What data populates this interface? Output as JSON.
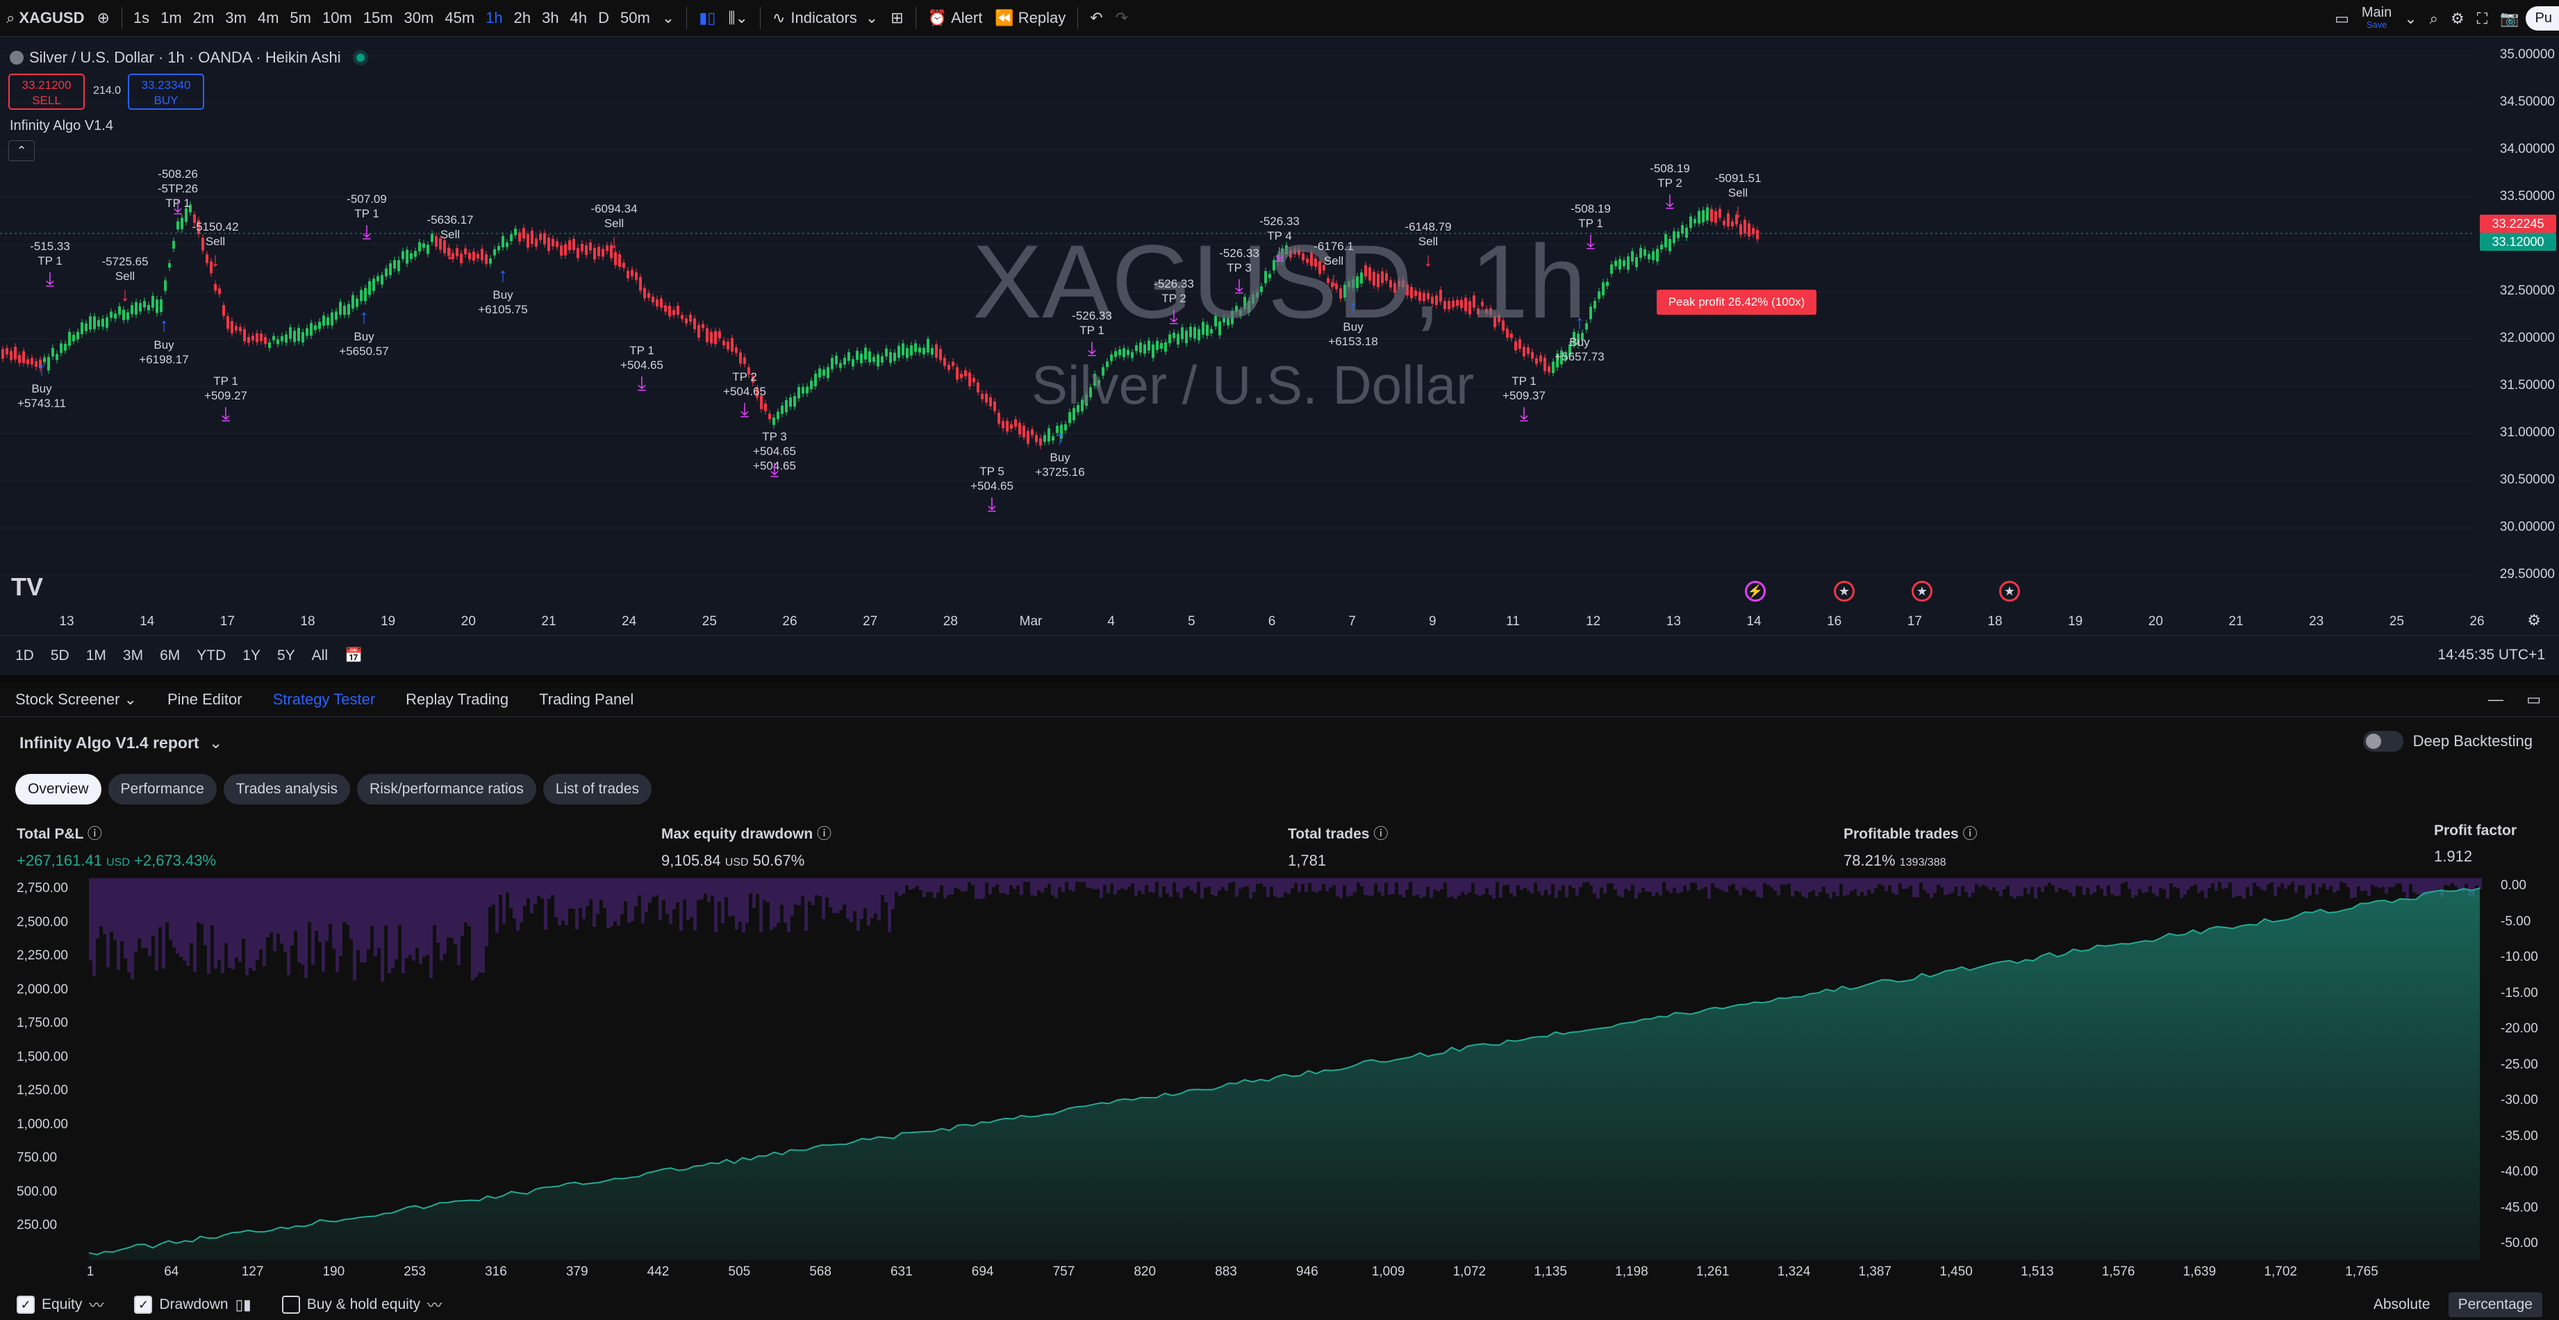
{
  "toolbar": {
    "symbol": "XAGUSD",
    "intervals": [
      "1s",
      "1m",
      "2m",
      "3m",
      "4m",
      "5m",
      "10m",
      "15m",
      "30m",
      "45m",
      "1h",
      "2h",
      "3h",
      "4h",
      "D",
      "50m"
    ],
    "active_interval": "1h",
    "indicators_label": "Indicators",
    "alert_label": "Alert",
    "replay_label": "Replay",
    "layout_name": "Main",
    "layout_sub": "Save",
    "publish_label": "Pu"
  },
  "chart": {
    "legend_title": "Silver / U.S. Dollar · 1h · OANDA · Heikin Ashi",
    "sell_price": "33.21200",
    "sell_label": "SELL",
    "spread": "214.0",
    "buy_price": "33.23340",
    "buy_label": "BUY",
    "indicator_label": "Infinity Algo V1.4",
    "watermark_symbol": "XAGUSD, 1h",
    "watermark_name": "Silver / U.S. Dollar",
    "peak_label": "Peak profit 26.42% (100x)",
    "price_axis": [
      "35.00000",
      "34.50000",
      "34.00000",
      "33.50000",
      "33.00000",
      "32.50000",
      "32.00000",
      "31.50000",
      "31.00000",
      "30.50000",
      "30.00000",
      "29.50000"
    ],
    "price_tag_1": "33.22245",
    "price_tag_2": "33.12000",
    "time_axis": [
      "13",
      "14",
      "17",
      "18",
      "19",
      "20",
      "21",
      "24",
      "25",
      "26",
      "27",
      "28",
      "Mar",
      "4",
      "5",
      "6",
      "7",
      "9",
      "11",
      "12",
      "13",
      "14",
      "16",
      "17",
      "18",
      "19",
      "20",
      "21",
      "23",
      "25",
      "26"
    ],
    "signals": [
      {
        "text": "-515.33\nTP 1"
      },
      {
        "text": "-5725.65\nSell"
      },
      {
        "text": "Buy\n+5743.11"
      },
      {
        "text": "Buy\n+6198.17"
      },
      {
        "text": "-508.26\n-5TP.26\nTP 1"
      },
      {
        "text": "-5150.42\nSell"
      },
      {
        "text": "TP 1\n+509.27"
      },
      {
        "text": "-507.09\nTP 1"
      },
      {
        "text": "Buy\n+5650.57"
      },
      {
        "text": "-5636.17\nSell"
      },
      {
        "text": "Buy\n+6105.75"
      },
      {
        "text": "-6094.34\nSell"
      },
      {
        "text": "TP 1\n+504.65"
      },
      {
        "text": "TP 2\n+504.65"
      },
      {
        "text": "TP 3\n+504.65\n+504.65"
      },
      {
        "text": "TP 5\n+504.65"
      },
      {
        "text": "Buy\n+3725.16"
      },
      {
        "text": "-526.33\nTP 1"
      },
      {
        "text": "-526.33\nTP 2"
      },
      {
        "text": "-526.33\nTP 3"
      },
      {
        "text": "-526.33\nTP 4"
      },
      {
        "text": "-6176.1\nSell"
      },
      {
        "text": "Buy\n+6153.18"
      },
      {
        "text": "-6148.79\nSell"
      },
      {
        "text": "TP 1\n+509.37"
      },
      {
        "text": "Buy\n+5657.73"
      },
      {
        "text": "-508.19\nTP 1"
      },
      {
        "text": "-508.19\nTP 2"
      },
      {
        "text": "-5091.51\nSell"
      }
    ]
  },
  "range_bar": {
    "ranges": [
      "1D",
      "5D",
      "1M",
      "3M",
      "6M",
      "YTD",
      "1Y",
      "5Y",
      "All"
    ],
    "time": "14:45:35 UTC+1"
  },
  "bottom_tabs": {
    "stock_screener": "Stock Screener",
    "pine_editor": "Pine Editor",
    "strategy_tester": "Strategy Tester",
    "replay_trading": "Replay Trading",
    "trading_panel": "Trading Panel"
  },
  "tester": {
    "report_title": "Infinity Algo V1.4 report",
    "deep_backtesting": "Deep Backtesting",
    "tabs": [
      "Overview",
      "Performance",
      "Trades analysis",
      "Risk/performance ratios",
      "List of trades"
    ],
    "metrics": {
      "total_pnl_label": "Total P&L",
      "total_pnl_value": "+267,161.41",
      "total_pnl_unit": "USD",
      "total_pnl_pct": "+2,673.43%",
      "max_dd_label": "Max equity drawdown",
      "max_dd_value": "9,105.84",
      "max_dd_unit": "USD",
      "max_dd_pct": "50.67%",
      "total_trades_label": "Total trades",
      "total_trades_value": "1,781",
      "profitable_label": "Profitable trades",
      "profitable_value": "78.21%",
      "profitable_detail": "1393/388",
      "profit_factor_label": "Profit factor",
      "profit_factor_value": "1.912"
    },
    "equity_y_left": [
      "2,750.00",
      "2,500.00",
      "2,250.00",
      "2,000.00",
      "1,750.00",
      "1,500.00",
      "1,250.00",
      "1,000.00",
      "750.00",
      "500.00",
      "250.00"
    ],
    "equity_y_right": [
      "0.00",
      "-5.00",
      "-10.00",
      "-15.00",
      "-20.00",
      "-25.00",
      "-30.00",
      "-35.00",
      "-40.00",
      "-45.00",
      "-50.00"
    ],
    "equity_x": [
      "1",
      "64",
      "127",
      "190",
      "253",
      "316",
      "379",
      "442",
      "505",
      "568",
      "631",
      "694",
      "757",
      "820",
      "883",
      "946",
      "1,009",
      "1,072",
      "1,135",
      "1,198",
      "1,261",
      "1,324",
      "1,387",
      "1,450",
      "1,513",
      "1,576",
      "1,639",
      "1,702",
      "1,765"
    ],
    "footer": {
      "equity": "Equity",
      "drawdown": "Drawdown",
      "buy_hold": "Buy & hold equity",
      "absolute": "Absolute",
      "percentage": "Percentage"
    }
  },
  "colors": {
    "up": "#22c55e",
    "down": "#f23645",
    "accent": "#2962ff",
    "tp": "#e040fb",
    "equity": "#22ab94"
  }
}
